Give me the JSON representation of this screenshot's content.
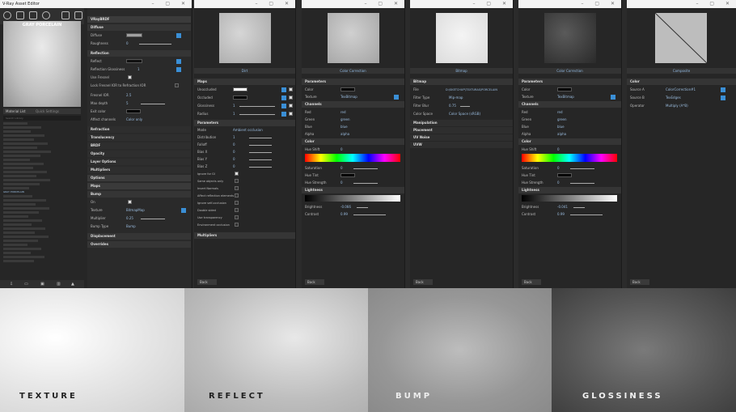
{
  "asset_editor": {
    "title": "V-Ray Asset Editor",
    "preview_name": "GRAY PORCELAIN",
    "tabs": [
      "Material List",
      "Quick Settings"
    ],
    "search_placeholder": "Search Library",
    "selected_item": "GRAY PORCELAIN",
    "material": {
      "name": "VRayBRDF",
      "diffuse_header": "Diffuse",
      "diffuse": "Diffuse",
      "roughness": "Roughness",
      "roughness_val": "0",
      "reflection_header": "Reflection",
      "reflect": "Reflect",
      "refl_gloss": "Reflection Glossiness",
      "refl_gloss_val": "1",
      "use_fresnel": "Use Fresnel",
      "lock_fresnel": "Lock Fresnel IOR to Refraction IOR",
      "fresnel_ior": "Fresnel IOR",
      "fresnel_ior_val": "2.5",
      "max_depth": "Max depth",
      "max_depth_val": "5",
      "exit_color": "Exit color",
      "affect_channels": "Affect channels",
      "affect_channels_val": "Color only",
      "collapsed": [
        "Refraction",
        "Translucency",
        "BRDF",
        "Opacity",
        "Layer Options",
        "Multipliers",
        "Options",
        "Maps"
      ],
      "bump_header": "Bump",
      "on": "On",
      "texture": "Texture",
      "texture_val": "BitmapMap",
      "multiplier": "Multiplier",
      "multiplier_val": "0.25",
      "bump_type": "Bump Type",
      "bump_type_val": "Bump",
      "after": [
        "Displacement",
        "Overrides"
      ]
    }
  },
  "dirt": {
    "header": "Dirt",
    "maps": "Maps",
    "rows": [
      {
        "l": "Unoccluded",
        "v": ""
      },
      {
        "l": "Occluded",
        "v": ""
      },
      {
        "l": "Glossiness",
        "v": "1"
      },
      {
        "l": "Radius",
        "v": "1"
      }
    ],
    "params": "Parameters",
    "mode": "Mode",
    "mode_val": "Ambient occlusion",
    "prow": [
      {
        "l": "Distribution",
        "v": "1"
      },
      {
        "l": "Falloff",
        "v": "0"
      },
      {
        "l": "Bias X",
        "v": "0"
      },
      {
        "l": "Bias Y",
        "v": "0"
      },
      {
        "l": "Bias Z",
        "v": "0"
      }
    ],
    "checks": [
      "Ignore for GI",
      "Same objects only",
      "Invert Normals",
      "Affect reflection elements",
      "Ignore self-occlusion",
      "Double sided",
      "Use transparency",
      "Environment occlusion"
    ],
    "multipliers": "Multipliers",
    "back": "Back"
  },
  "cc1": {
    "header": "Color Correction",
    "params": "Parameters",
    "color": "Color",
    "texture": "Texture",
    "texture_val": "TexBitmap",
    "channels": "Channels",
    "ch": [
      {
        "l": "Red",
        "v": "red"
      },
      {
        "l": "Green",
        "v": "green"
      },
      {
        "l": "Blue",
        "v": "blue"
      },
      {
        "l": "Alpha",
        "v": "alpha"
      }
    ],
    "color_sec": "Color",
    "hue_shift": "Hue Shift",
    "hue_shift_val": "0",
    "saturation": "Saturation",
    "saturation_val": "0",
    "hue_tint": "Hue Tint",
    "hue_strength": "Hue Strength",
    "hue_strength_val": "0",
    "lightness": "Lightness",
    "brightness": "Brightness",
    "brightness_val": "-0.066",
    "contrast": "Contrast",
    "contrast_val": "0.99",
    "back": "Back"
  },
  "bitmap": {
    "header": "Bitmap",
    "section": "Bitmap",
    "file": "File",
    "file_val": "D:\\SKETCHUP\\TEXTURAS\\PORCELAIN",
    "filter_type": "Filter Type",
    "filter_type_val": "Mip-map",
    "filter_blur": "Filter Blur",
    "filter_blur_val": "0.75",
    "color_space": "Color Space",
    "color_space_val": "Color Space (sRGB)",
    "collapsed": [
      "Manipulation",
      "Placement",
      "UV Noise",
      "UVW"
    ],
    "back": "Back"
  },
  "cc2": {
    "header": "Color Correction",
    "params": "Parameters",
    "color": "Color",
    "texture": "Texture",
    "texture_val": "TexBitmap",
    "channels": "Channels",
    "ch": [
      {
        "l": "Red",
        "v": "red"
      },
      {
        "l": "Green",
        "v": "green"
      },
      {
        "l": "Blue",
        "v": "blue"
      },
      {
        "l": "Alpha",
        "v": "alpha"
      }
    ],
    "color_sec": "Color",
    "hue_shift": "Hue Shift",
    "hue_shift_val": "0",
    "saturation": "Saturation",
    "saturation_val": "0",
    "hue_tint": "Hue Tint",
    "hue_strength": "Hue Strength",
    "hue_strength_val": "0",
    "lightness": "Lightness",
    "brightness": "Brightness",
    "brightness_val": "-0.041",
    "contrast": "Contrast",
    "contrast_val": "0.99",
    "back": "Back"
  },
  "composite": {
    "header": "Composite",
    "section": "Color",
    "source_a": "Source A",
    "source_a_val": "ColorCorrection#1",
    "source_b": "Source B",
    "source_b_val": "TexEdges",
    "operator": "Operator",
    "operator_val": "Multiply (A*B)",
    "back": "Back"
  },
  "tiles": [
    {
      "label": "TEXTURE"
    },
    {
      "label": "REFLECT"
    },
    {
      "label": "BUMP"
    },
    {
      "label": "GLOSSINESS"
    }
  ],
  "colors": {
    "accent": "#3a8fd6",
    "panel": "#262626",
    "value": "#9bbde0"
  }
}
